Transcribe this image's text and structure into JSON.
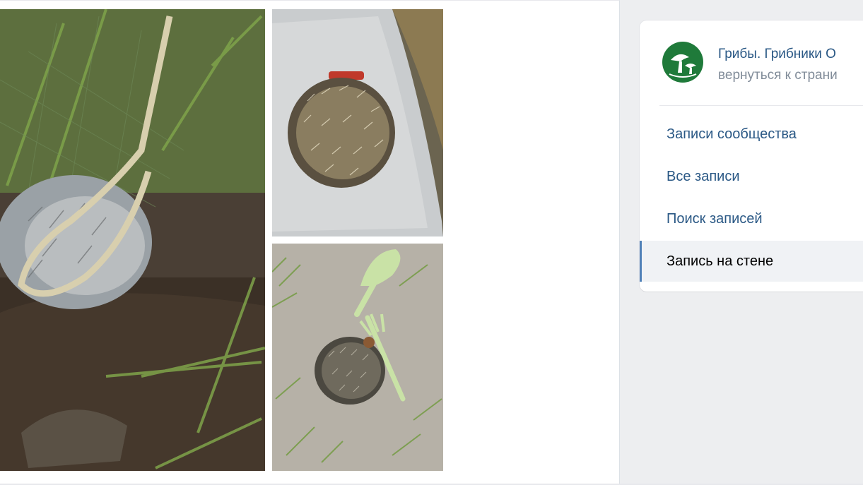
{
  "post": {
    "photos": [
      {
        "name": "hedgehog-in-net-photo"
      },
      {
        "name": "hedgehog-on-towel-photo"
      },
      {
        "name": "hedgehog-with-tools-photo"
      }
    ]
  },
  "sidebar": {
    "group_name": "Грибы. Грибники О",
    "back_link": "вернуться к страни",
    "nav": [
      {
        "label": "Записи сообщества",
        "active": false
      },
      {
        "label": "Все записи",
        "active": false
      },
      {
        "label": "Поиск записей",
        "active": false
      },
      {
        "label": "Запись на стене",
        "active": true
      }
    ]
  },
  "colors": {
    "link": "#2a5885",
    "muted": "#818c99",
    "active_bg": "#f0f2f5",
    "active_marker": "#5181b8",
    "page_bg": "#edeef0",
    "avatar_green": "#1f7a3a"
  }
}
